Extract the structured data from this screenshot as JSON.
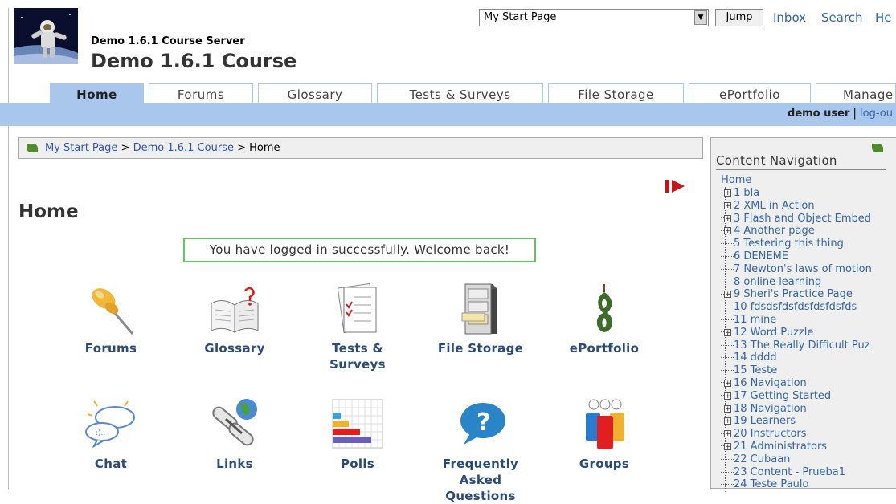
{
  "header": {
    "server_name": "Demo 1.6.1 Course Server",
    "course_title": "Demo 1.6.1 Course",
    "jump_select_value": "My Start Page",
    "jump_button": "Jump",
    "links": [
      "Inbox",
      "Search",
      "He"
    ]
  },
  "tabs": [
    {
      "label": "Home",
      "active": true
    },
    {
      "label": "Forums"
    },
    {
      "label": "Glossary"
    },
    {
      "label": "Tests & Surveys"
    },
    {
      "label": "File Storage"
    },
    {
      "label": "ePortfolio"
    },
    {
      "label": "Manage"
    }
  ],
  "user": {
    "name": "demo user",
    "separator": "|",
    "logout": "log-ou"
  },
  "breadcrumb": {
    "items": [
      "My Start Page",
      "Demo 1.6.1 Course",
      "Home"
    ],
    "separator": ">"
  },
  "main": {
    "heading": "Home",
    "welcome": "You have logged in successfully. Welcome back!",
    "tools": [
      {
        "label": "Forums",
        "icon": "pushpin-icon"
      },
      {
        "label": "Glossary",
        "icon": "open-book-icon"
      },
      {
        "label": "Tests & Surveys",
        "icon": "checklist-document-icon"
      },
      {
        "label": "File Storage",
        "icon": "filing-cabinet-icon"
      },
      {
        "label": "ePortfolio",
        "icon": "greenstone-pendant-icon"
      },
      {
        "label": "Chat",
        "icon": "speech-bubbles-icon"
      },
      {
        "label": "Links",
        "icon": "chain-link-globe-icon"
      },
      {
        "label": "Polls",
        "icon": "bar-chart-icon"
      },
      {
        "label": "Frequently Asked Questions",
        "icon": "question-bubble-icon"
      },
      {
        "label": "Groups",
        "icon": "people-group-icon"
      }
    ]
  },
  "sidenav": {
    "title": "Content Navigation",
    "home": "Home",
    "items": [
      {
        "label": "1 bla",
        "expandable": true
      },
      {
        "label": "2 XML in Action",
        "expandable": true
      },
      {
        "label": "3 Flash and Object Embed",
        "expandable": true
      },
      {
        "label": "4 Another page",
        "expandable": true
      },
      {
        "label": "5 Testering this thing",
        "expandable": false
      },
      {
        "label": "6 DENEME",
        "expandable": false
      },
      {
        "label": "7 Newton's laws of motion",
        "expandable": false
      },
      {
        "label": "8 online learning",
        "expandable": false
      },
      {
        "label": "9 Sheri's Practice Page",
        "expandable": true
      },
      {
        "label": "10 fdsdsfdsfdsfdsfdsfds",
        "expandable": false
      },
      {
        "label": "11 mine",
        "expandable": false
      },
      {
        "label": "12 Word Puzzle",
        "expandable": true
      },
      {
        "label": "13 The Really Difficult Puz",
        "expandable": false
      },
      {
        "label": "14 dddd",
        "expandable": false
      },
      {
        "label": "15 Teste",
        "expandable": false
      },
      {
        "label": "16 Navigation",
        "expandable": true
      },
      {
        "label": "17 Getting Started",
        "expandable": true
      },
      {
        "label": "18 Navigation",
        "expandable": true
      },
      {
        "label": "19 Learners",
        "expandable": true
      },
      {
        "label": "20 Instructors",
        "expandable": true
      },
      {
        "label": "21 Administrators",
        "expandable": true
      },
      {
        "label": "22 Cubaan",
        "expandable": false
      },
      {
        "label": "23 Content - Prueba1",
        "expandable": false
      },
      {
        "label": "24 Teste Paulo",
        "expandable": false
      }
    ]
  },
  "colors": {
    "tab_bar": "#a9c6ec",
    "link": "#3366aa",
    "welcome_border": "#66c266"
  }
}
